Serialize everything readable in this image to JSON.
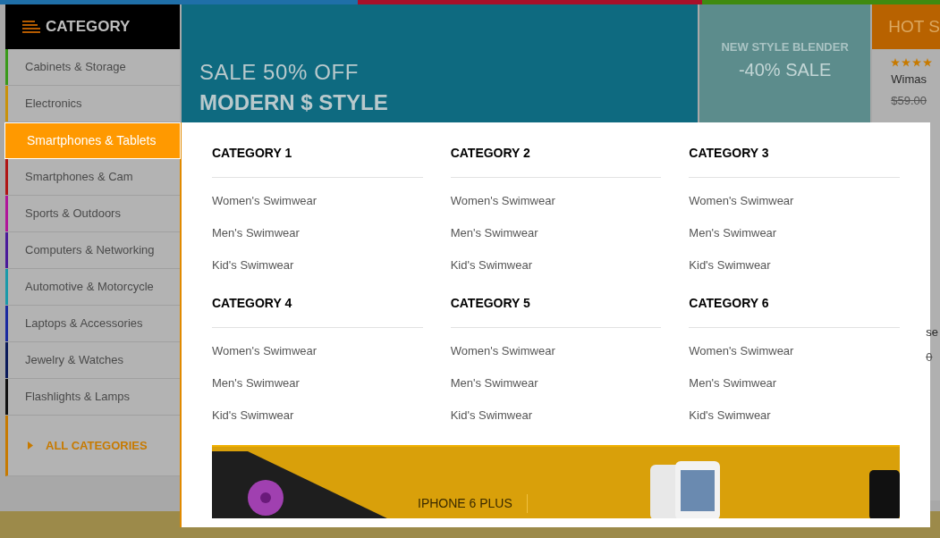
{
  "sidebar": {
    "title": "CATEGORY",
    "items": [
      {
        "label": "Cabinets & Storage",
        "color": "#3a9a1a",
        "selected": false
      },
      {
        "label": "Electronics",
        "color": "#c9920a",
        "selected": false
      },
      {
        "label": "Smartphones & Tablets",
        "color": "#ff9900",
        "selected": true
      },
      {
        "label": "Smartphones & Cam",
        "color": "#b01515",
        "selected": false
      },
      {
        "label": "Sports & Outdoors",
        "color": "#b0159a",
        "selected": false
      },
      {
        "label": "Computers & Networking",
        "color": "#4a1a9a",
        "selected": false
      },
      {
        "label": "Automotive & Motorcycle",
        "color": "#1a9aaa",
        "selected": false
      },
      {
        "label": "Laptops & Accessories",
        "color": "#1a2aa0",
        "selected": false
      },
      {
        "label": "Jewelry & Watches",
        "color": "#0a1a5a",
        "selected": false
      },
      {
        "label": "Flashlights & Lamps",
        "color": "#111111",
        "selected": false
      }
    ],
    "all_categories": "ALL CATEGORIES"
  },
  "main_banner": {
    "headline": "SALE 50% OFF",
    "subheadline": "MODERN $ STYLE"
  },
  "side_banner": {
    "headline": "NEW STYLE BLENDER",
    "subheadline": "-40% SALE"
  },
  "hot_deals": {
    "title": "HOT S",
    "products": [
      {
        "stars": 4,
        "name": "Wimas",
        "price": "$59.00"
      },
      {
        "name": "se",
        "price": "0"
      }
    ]
  },
  "mega_menu": {
    "groups": [
      {
        "title": "CATEGORY 1",
        "links": [
          "Women's Swimwear",
          "Men's Swimwear",
          "Kid's Swimwear"
        ]
      },
      {
        "title": "CATEGORY 2",
        "links": [
          "Women's Swimwear",
          "Men's Swimwear",
          "Kid's Swimwear"
        ]
      },
      {
        "title": "CATEGORY 3",
        "links": [
          "Women's Swimwear",
          "Men's Swimwear",
          "Kid's Swimwear"
        ]
      },
      {
        "title": "CATEGORY 4",
        "links": [
          "Women's Swimwear",
          "Men's Swimwear",
          "Kid's Swimwear"
        ]
      },
      {
        "title": "CATEGORY 5",
        "links": [
          "Women's Swimwear",
          "Men's Swimwear",
          "Kid's Swimwear"
        ]
      },
      {
        "title": "CATEGORY 6",
        "links": [
          "Women's Swimwear",
          "Men's Swimwear",
          "Kid's Swimwear"
        ]
      }
    ],
    "banner_text": "IPHONE 6 PLUS"
  }
}
